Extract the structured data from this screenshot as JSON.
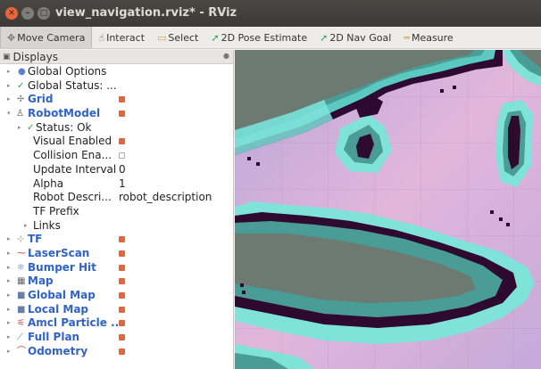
{
  "window": {
    "title": "view_navigation.rviz* - RViz"
  },
  "toolbar": {
    "tools": [
      {
        "label": "Move Camera",
        "icon": "move-camera-icon"
      },
      {
        "label": "Interact",
        "icon": "interact-icon"
      },
      {
        "label": "Select",
        "icon": "select-icon"
      },
      {
        "label": "2D Pose Estimate",
        "icon": "pose-estimate-arrow-icon"
      },
      {
        "label": "2D Nav Goal",
        "icon": "nav-goal-arrow-icon"
      },
      {
        "label": "Measure",
        "icon": "measure-icon"
      }
    ]
  },
  "displays": {
    "title": "Displays",
    "items": {
      "global_options": "Global Options",
      "global_status": "Global Status: ...",
      "grid": "Grid",
      "robot_model": "RobotModel",
      "status": "Status: Ok",
      "visual_enabled": "Visual Enabled",
      "collision_enabled": "Collision Ena...",
      "update_interval": "Update Interval",
      "update_interval_value": "0",
      "alpha": "Alpha",
      "alpha_value": "1",
      "robot_description": "Robot Descri...",
      "robot_description_value": "robot_description",
      "tf_prefix": "TF Prefix",
      "links": "Links",
      "tf": "TF",
      "laser_scan": "LaserScan",
      "bumper_hit": "Bumper Hit",
      "map": "Map",
      "global_map": "Global Map",
      "local_map": "Local Map",
      "amcl_particle": "Amcl Particle ...",
      "full_plan": "Full Plan",
      "odometry": "Odometry"
    }
  },
  "colors": {
    "accent_checkbox": "#e2653c",
    "display_name_blue": "#2f63c9",
    "map_costmap_cyan": "#7fe3da",
    "map_inflation_teal": "#4a9c96",
    "map_obstacle": "#3a0f3c",
    "map_free_pink": "#e2b6dc",
    "map_gray_region": "#6c7a72"
  }
}
